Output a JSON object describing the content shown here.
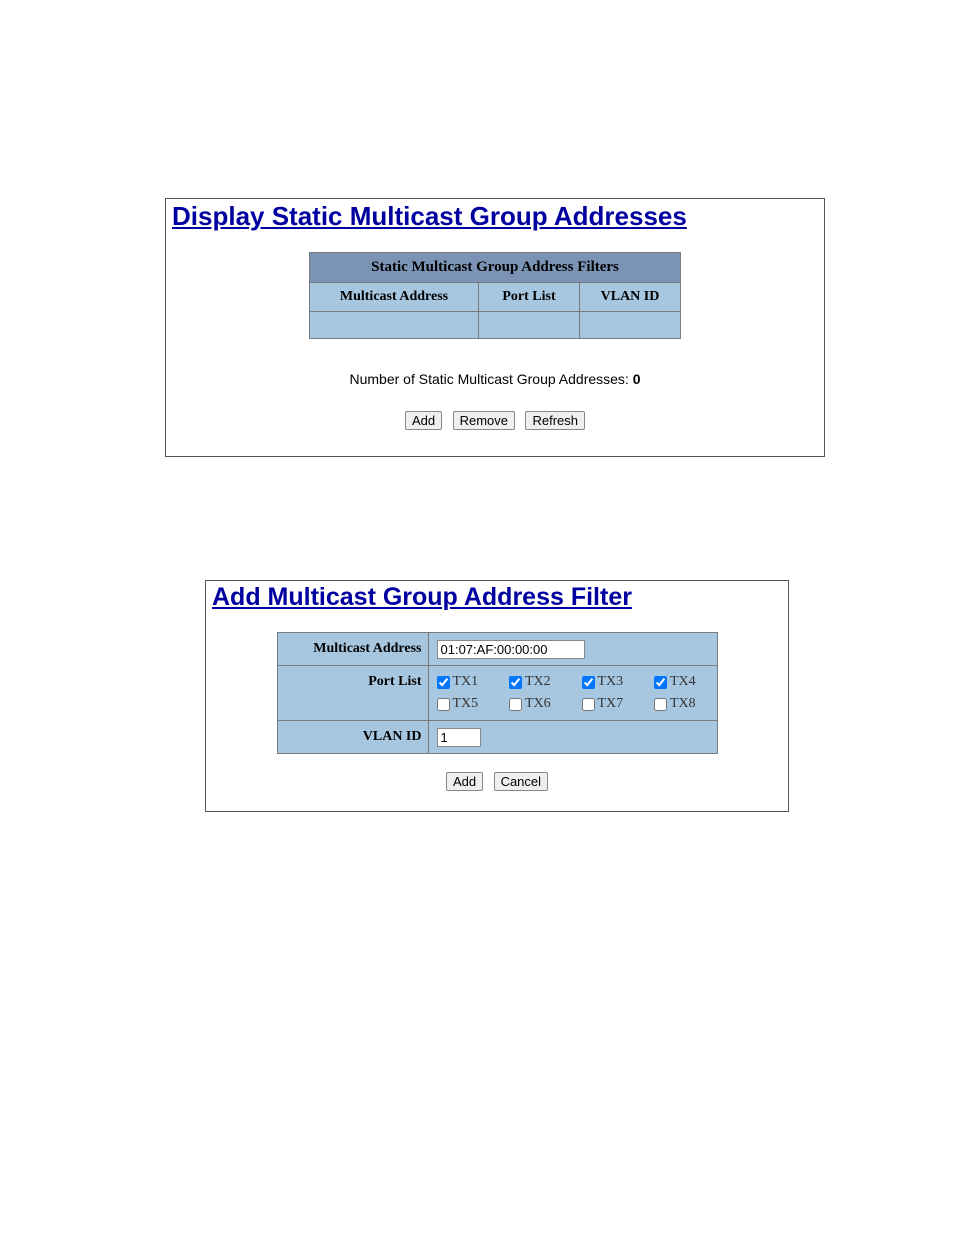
{
  "panel_display": {
    "title": "Display Static Multicast Group Addresses",
    "table_header": "Static Multicast Group Address Filters",
    "columns": [
      "Multicast Address",
      "Port List",
      "VLAN ID"
    ],
    "count_label_prefix": "Number of Static Multicast Group Addresses: ",
    "count_value": "0",
    "buttons": {
      "add": "Add",
      "remove": "Remove",
      "refresh": "Refresh"
    }
  },
  "panel_add": {
    "title": "Add Multicast Group Address Filter",
    "labels": {
      "multicast_address": "Multicast Address",
      "port_list": "Port List",
      "vlan_id": "VLAN ID"
    },
    "fields": {
      "multicast_address_value": "01:07:AF:00:00:00",
      "vlan_id_value": "1"
    },
    "ports": [
      {
        "label": "TX1",
        "checked": true
      },
      {
        "label": "TX2",
        "checked": true
      },
      {
        "label": "TX3",
        "checked": true
      },
      {
        "label": "TX4",
        "checked": true
      },
      {
        "label": "TX5",
        "checked": false
      },
      {
        "label": "TX6",
        "checked": false
      },
      {
        "label": "TX7",
        "checked": false
      },
      {
        "label": "TX8",
        "checked": false
      }
    ],
    "buttons": {
      "add": "Add",
      "cancel": "Cancel"
    }
  }
}
